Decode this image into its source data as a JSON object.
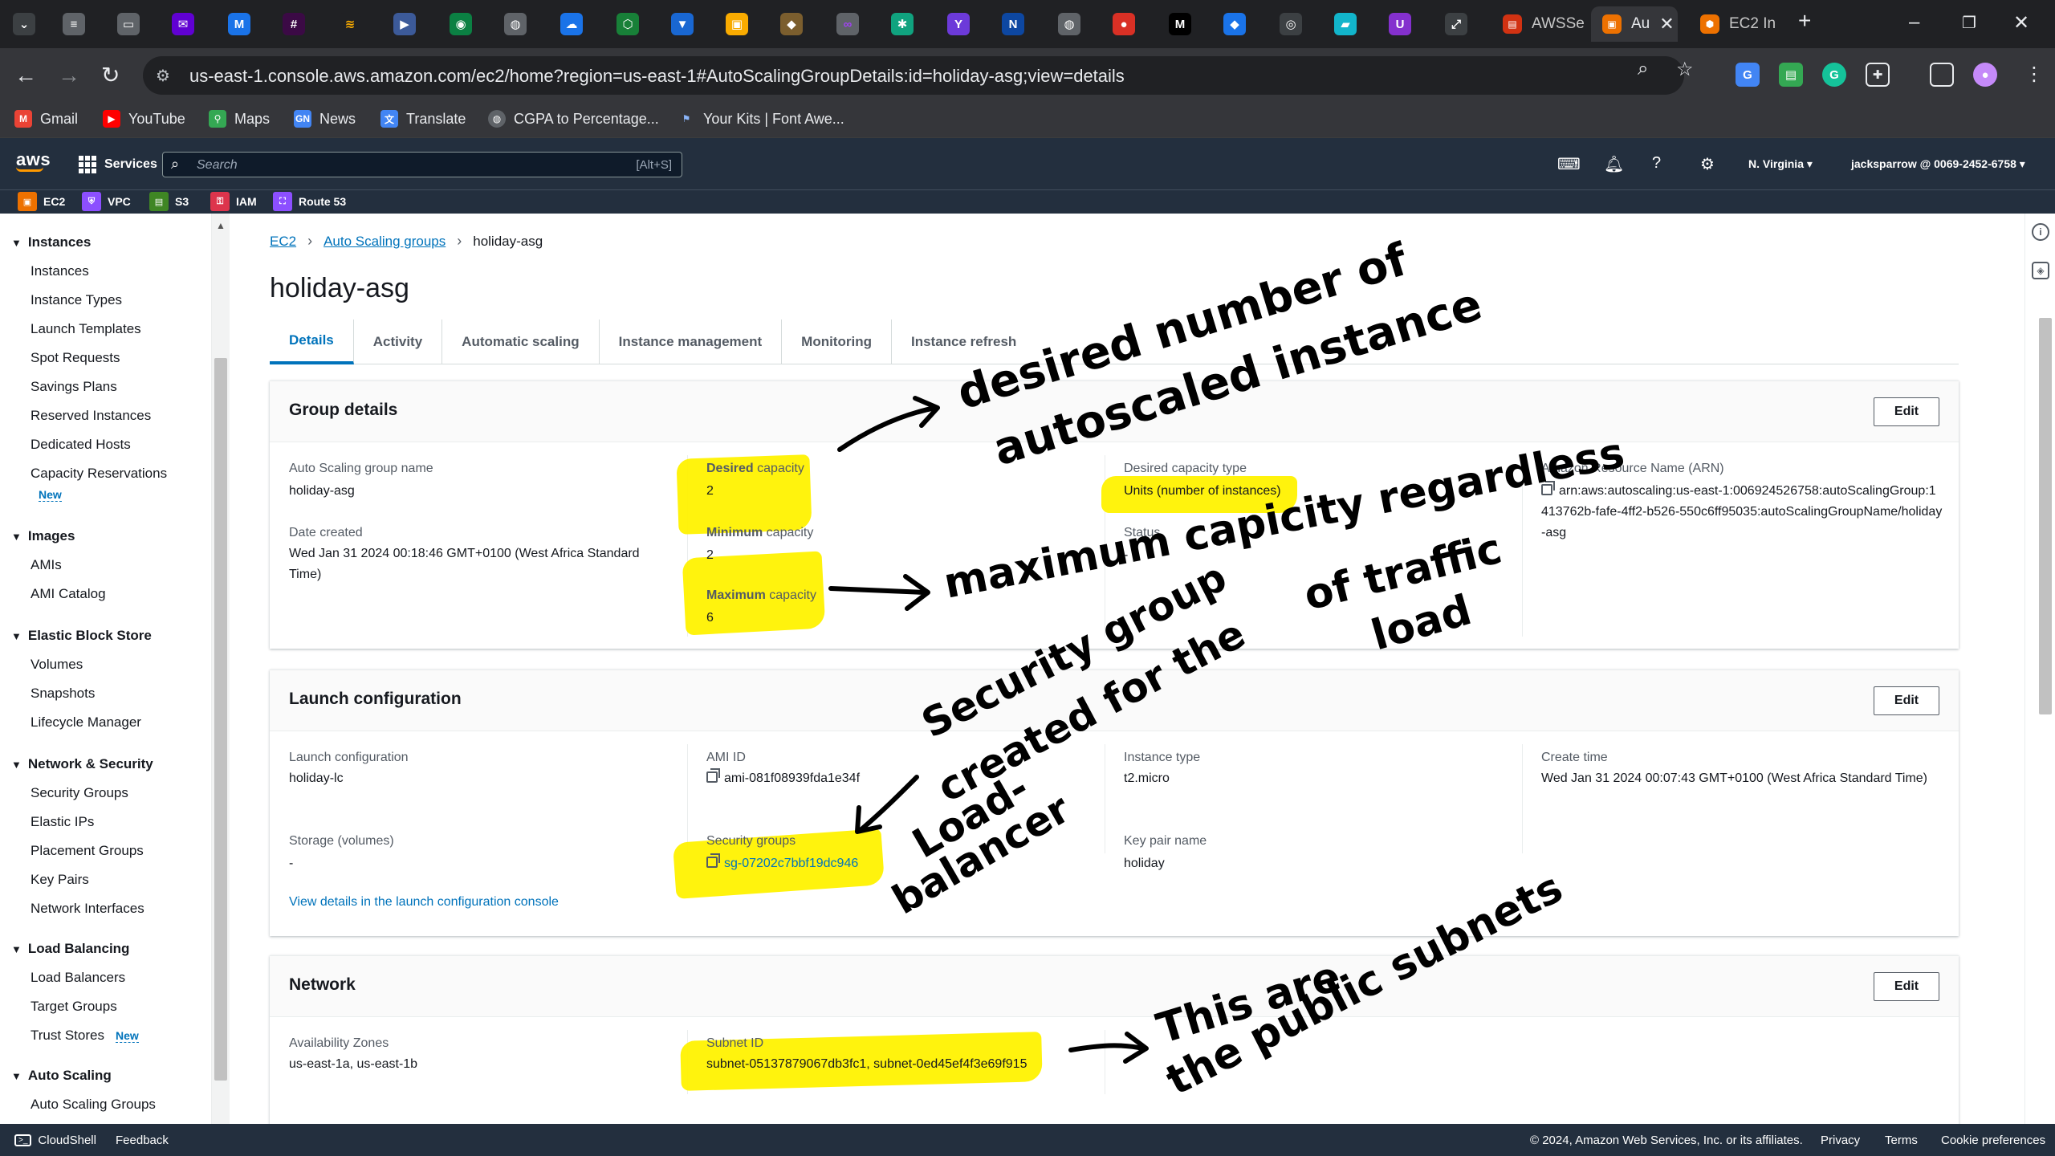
{
  "browser": {
    "tabs": [
      {
        "label": "AWSSe",
        "active": false
      },
      {
        "label": "Au",
        "active": true
      },
      {
        "label": "EC2 In",
        "active": false
      }
    ],
    "url": "us-east-1.console.aws.amazon.com/ec2/home?region=us-east-1#AutoScalingGroupDetails:id=holiday-asg;view=details",
    "bookmarks": [
      "Gmail",
      "YouTube",
      "Maps",
      "News",
      "Translate",
      "CGPA to Percentage...",
      "Your Kits | Font Awe..."
    ]
  },
  "console": {
    "services_label": "Services",
    "search_placeholder": "Search",
    "search_shortcut": "[Alt+S]",
    "region": "N. Virginia ▾",
    "account": "jacksparrow @ 0069-2452-6758 ▾",
    "favorites": [
      "EC2",
      "VPC",
      "S3",
      "IAM",
      "Route 53"
    ]
  },
  "sidebar": {
    "sections": [
      {
        "title": "Instances",
        "items": [
          "Instances",
          "Instance Types",
          "Launch Templates",
          "Spot Requests",
          "Savings Plans",
          "Reserved Instances",
          "Dedicated Hosts",
          "Capacity Reservations"
        ]
      },
      {
        "title": "Images",
        "items": [
          "AMIs",
          "AMI Catalog"
        ]
      },
      {
        "title": "Elastic Block Store",
        "items": [
          "Volumes",
          "Snapshots",
          "Lifecycle Manager"
        ]
      },
      {
        "title": "Network & Security",
        "items": [
          "Security Groups",
          "Elastic IPs",
          "Placement Groups",
          "Key Pairs",
          "Network Interfaces"
        ]
      },
      {
        "title": "Load Balancing",
        "items": [
          "Load Balancers",
          "Target Groups",
          "Trust Stores"
        ]
      },
      {
        "title": "Auto Scaling",
        "items": [
          "Auto Scaling Groups"
        ]
      }
    ],
    "new_badge": "New"
  },
  "main": {
    "breadcrumb": [
      "EC2",
      "Auto Scaling groups",
      "holiday-asg"
    ],
    "title": "holiday-asg",
    "tabs": [
      "Details",
      "Activity",
      "Automatic scaling",
      "Instance management",
      "Monitoring",
      "Instance refresh"
    ],
    "edit_label": "Edit",
    "group_details": {
      "title": "Group details",
      "asg_name_label": "Auto Scaling group name",
      "asg_name": "holiday-asg",
      "date_created_label": "Date created",
      "date_created": "Wed Jan 31 2024 00:18:46 GMT+0100 (West Africa Standard Time)",
      "desired_label_bold": "Desired",
      "desired_label_rest": " capacity",
      "desired": "2",
      "minimum_label_bold": "Minimum",
      "minimum_label_rest": " capacity",
      "minimum": "2",
      "maximum_label_bold": "Maximum",
      "maximum_label_rest": " capacity",
      "maximum": "6",
      "capacity_type_label": "Desired capacity type",
      "capacity_type": "Units (number of instances)",
      "status_label": "Status",
      "status": "-",
      "arn_label": "Amazon Resource Name (ARN)",
      "arn": "arn:aws:autoscaling:us-east-1:006924526758:autoScalingGroup:1413762b-fafe-4ff2-b526-550c6ff95035:autoScalingGroupName/holiday-asg"
    },
    "launch_config": {
      "title": "Launch configuration",
      "lc_label": "Launch configuration",
      "lc": "holiday-lc",
      "ami_label": "AMI ID",
      "ami": "ami-081f08939fda1e34f",
      "instance_type_label": "Instance type",
      "instance_type": "t2.micro",
      "create_time_label": "Create time",
      "create_time": "Wed Jan 31 2024 00:07:43 GMT+0100 (West Africa Standard Time)",
      "storage_label": "Storage (volumes)",
      "storage": "-",
      "sg_label": "Security groups",
      "sg": "sg-07202c7bbf19dc946",
      "key_pair_label": "Key pair name",
      "key_pair": "holiday",
      "view_link": "View details in the launch configuration console"
    },
    "network": {
      "title": "Network",
      "az_label": "Availability Zones",
      "az": "us-east-1a, us-east-1b",
      "subnet_label": "Subnet ID",
      "subnet": "subnet-05137879067db3fc1, subnet-0ed45ef4f3e69f915"
    }
  },
  "annotations": {
    "desired": [
      "desired number of",
      "autoscaled instance"
    ],
    "maximum": [
      "maximum capicity regardless",
      "of traffic",
      "load"
    ],
    "security": [
      "Security group",
      "created for the",
      "Load-",
      "balancer"
    ],
    "subnets": [
      "This are",
      "the public subnets"
    ]
  },
  "footer": {
    "cloudshell": "CloudShell",
    "feedback": "Feedback",
    "copyright": "© 2024, Amazon Web Services, Inc. or its affiliates.",
    "privacy": "Privacy",
    "terms": "Terms",
    "cookies": "Cookie preferences"
  },
  "colors": {
    "aws_nav": "#232f3e",
    "link": "#0073bb",
    "highlight": "#fff200",
    "orange": "#ff9900"
  }
}
